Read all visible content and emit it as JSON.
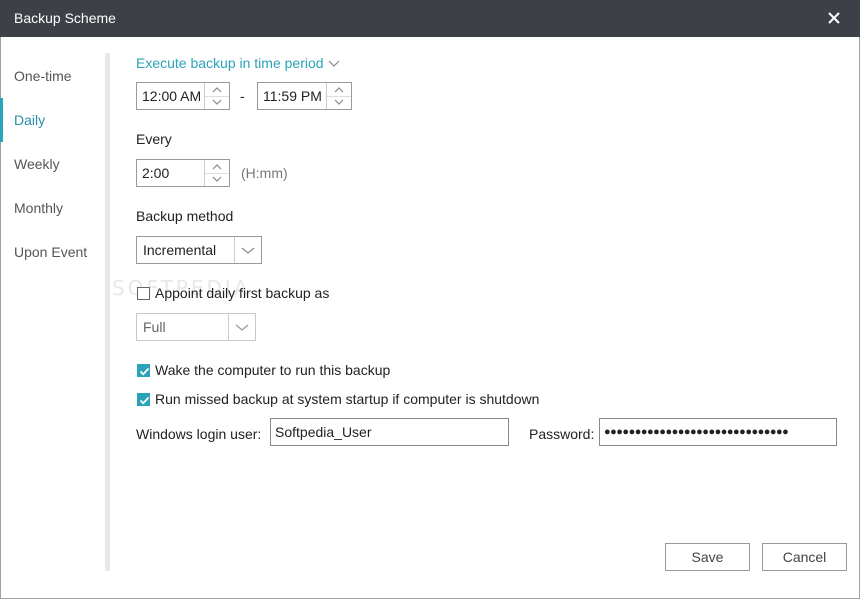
{
  "window": {
    "title": "Backup Scheme"
  },
  "sidebar": {
    "items": [
      {
        "label": "One-time"
      },
      {
        "label": "Daily"
      },
      {
        "label": "Weekly"
      },
      {
        "label": "Monthly"
      },
      {
        "label": "Upon Event"
      }
    ],
    "selected": "Daily"
  },
  "period": {
    "mode_label": "Execute backup in time period",
    "start_time": "12:00 AM",
    "separator": "-",
    "end_time": "11:59 PM"
  },
  "every": {
    "label": "Every",
    "value": "2:00",
    "unit_hint": "(H:mm)"
  },
  "backup_method": {
    "label": "Backup method",
    "value": "Incremental"
  },
  "first_backup": {
    "label": "Appoint daily first backup as",
    "checked": false,
    "value": "Full"
  },
  "options": {
    "wake_label": "Wake the computer to run this backup",
    "wake_checked": true,
    "missed_label": "Run missed backup at system startup if computer is shutdown",
    "missed_checked": true
  },
  "login": {
    "user_label": "Windows login user:",
    "user_value": "Softpedia_User",
    "password_label": "Password:",
    "password_value": "●●●●●●●●●●●●●●●●●●●●●●●●●●●●●●"
  },
  "buttons": {
    "save": "Save",
    "cancel": "Cancel"
  },
  "watermark": "SOFTPEDIA",
  "colors": {
    "accent": "#2aa3b8",
    "titlebar": "#3d4047"
  },
  "icons": {
    "close": "close-icon",
    "dropdown": "chevron-down-icon",
    "spin_up": "chevron-up-icon",
    "spin_down": "chevron-down-icon",
    "check": "checkmark-icon"
  }
}
